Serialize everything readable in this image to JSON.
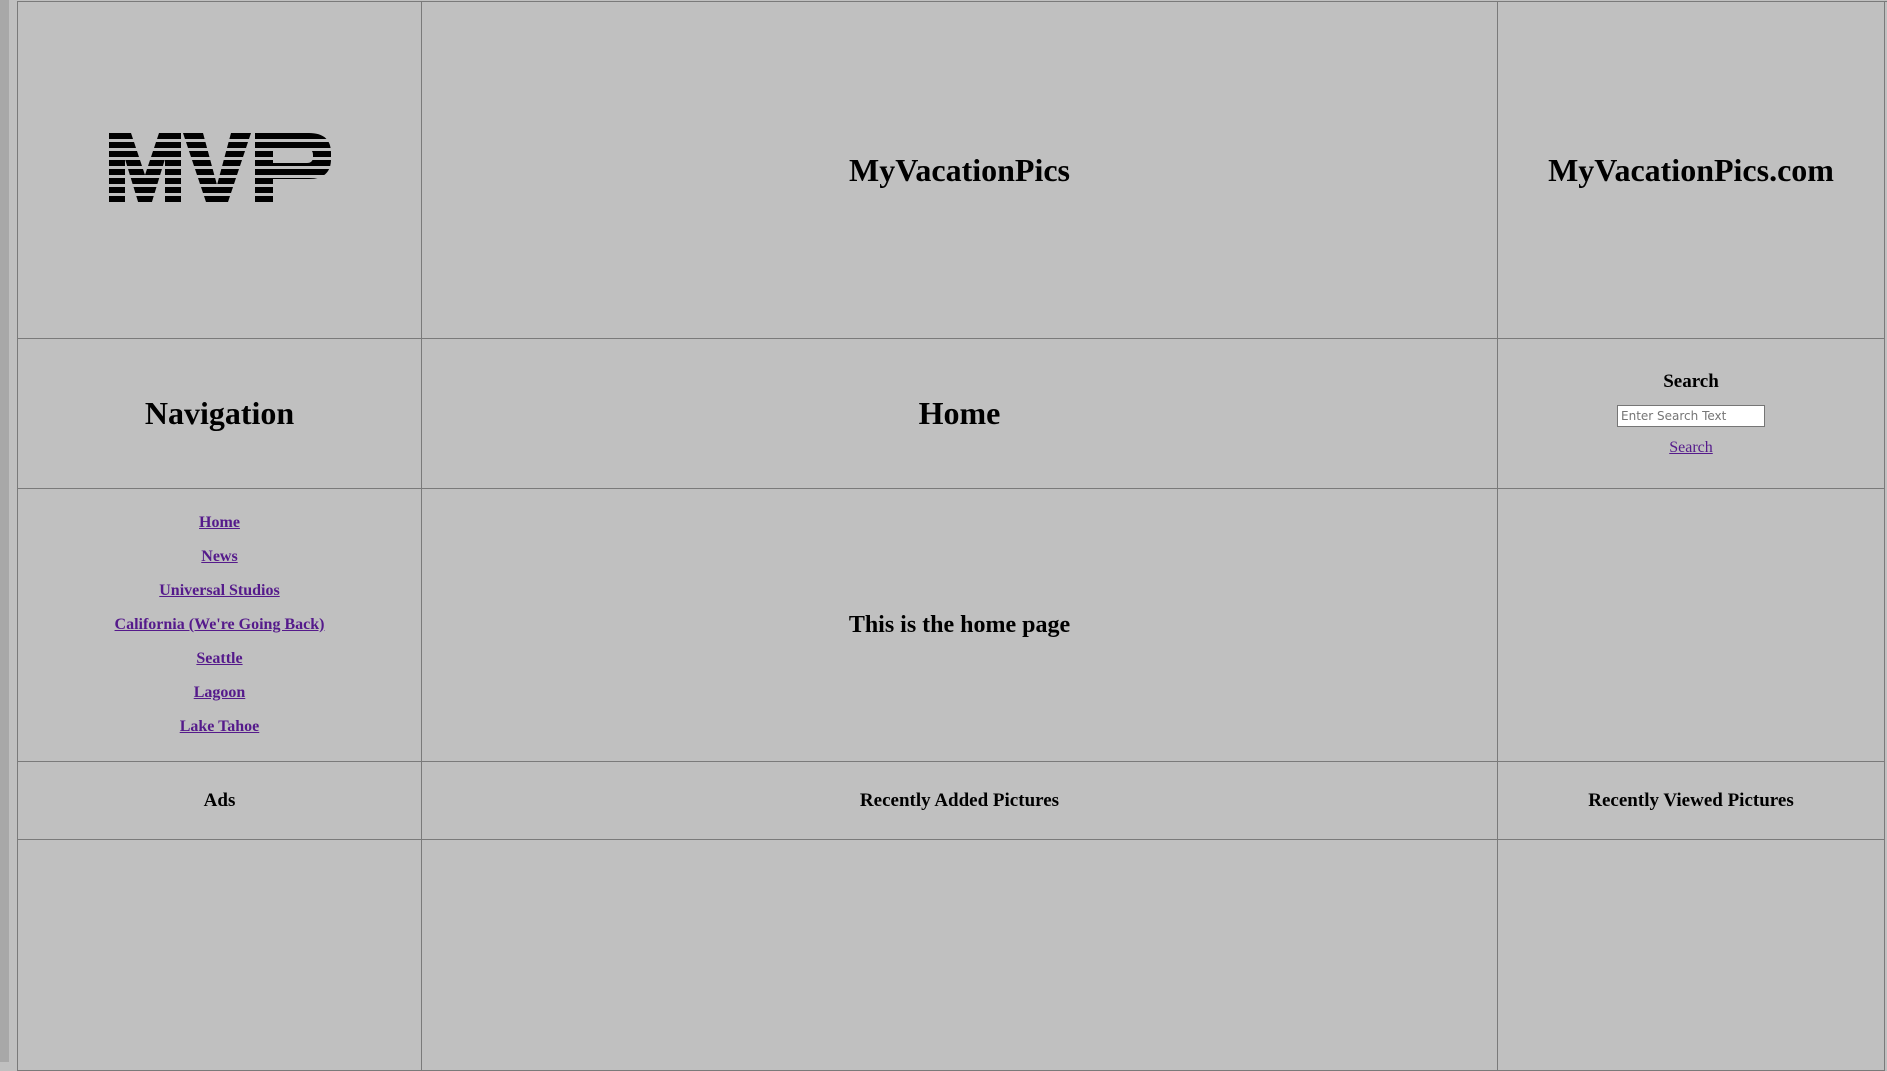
{
  "header": {
    "logo_text": "MVP",
    "site_title": "MyVacationPics",
    "site_domain": "MyVacationPics.com"
  },
  "sections": {
    "navigation_title": "Navigation",
    "page_title": "Home"
  },
  "search": {
    "heading": "Search",
    "placeholder": "Enter Search Text",
    "link_label": "Search"
  },
  "nav": {
    "items": [
      {
        "label": "Home"
      },
      {
        "label": "News"
      },
      {
        "label": "Universal Studios"
      },
      {
        "label": "California (We're Going Back)"
      },
      {
        "label": "Seattle"
      },
      {
        "label": "Lagoon"
      },
      {
        "label": "Lake Tahoe"
      }
    ]
  },
  "main": {
    "body_text": "This is the home page"
  },
  "footer": {
    "ads_heading": "Ads",
    "recently_added_heading": "Recently Added Pictures",
    "recently_viewed_heading": "Recently Viewed Pictures"
  },
  "colors": {
    "background": "#c0c0c0",
    "link": "#551a8b",
    "border": "#7a7a7a"
  }
}
